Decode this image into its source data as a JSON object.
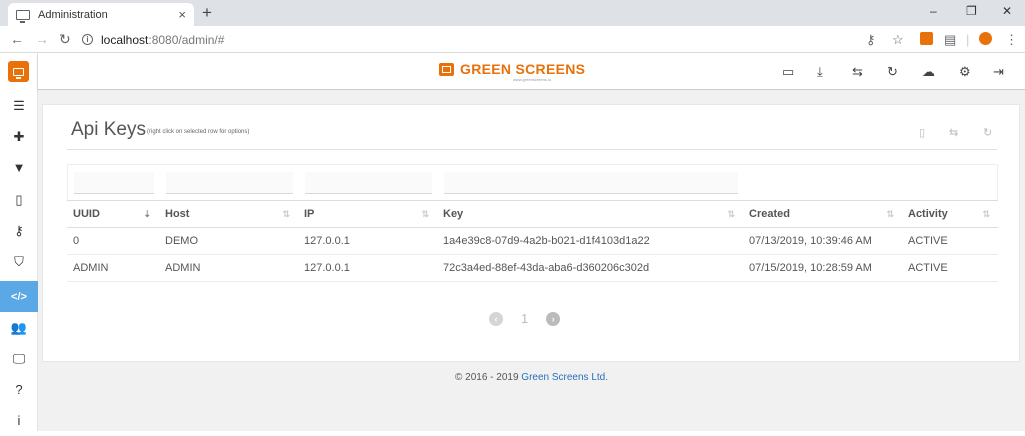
{
  "browser": {
    "tab_title": "Administration",
    "tab_close": "×",
    "new_tab": "+",
    "url_host": "localhost",
    "url_path": ":8080/admin/#",
    "win_minimize": "–",
    "win_restore": "❐",
    "win_close": "✕"
  },
  "app": {
    "brand_name_1": "GREEN",
    "brand_name_2": "SCREENS",
    "brand_sub": "www.greenscreens.io",
    "accent_color": "#e8710a",
    "active_color": "#5aa9e6",
    "sidebar": [
      {
        "icon": "list-icon",
        "glyph": "☰"
      },
      {
        "icon": "puzzle-icon",
        "glyph": "✚"
      },
      {
        "icon": "filter-icon",
        "glyph": "▼"
      },
      {
        "icon": "mobile-icon",
        "glyph": "▯"
      },
      {
        "icon": "key-icon",
        "glyph": "⚷"
      },
      {
        "icon": "shield-icon",
        "glyph": "⛉"
      },
      {
        "icon": "code-icon",
        "glyph": "</>"
      },
      {
        "icon": "users-icon",
        "glyph": "👥"
      },
      {
        "icon": "desktop-icon",
        "glyph": "🖵"
      },
      {
        "icon": "help-icon",
        "glyph": "?"
      },
      {
        "icon": "info-icon",
        "glyph": "i"
      }
    ],
    "topbar_icons": [
      "window-icon",
      "download-icon",
      "retweet-icon",
      "refresh-icon",
      "cloud-icon",
      "cogs-icon",
      "logout-icon"
    ]
  },
  "panel": {
    "title": "Api Keys",
    "hint": "(right click on selected row for options)",
    "columns": [
      "UUID",
      "Host",
      "IP",
      "Key",
      "Created",
      "Activity"
    ],
    "rows": [
      {
        "uuid": "0",
        "host": "DEMO",
        "ip": "127.0.0.1",
        "key": "1a4e39c8-07d9-4a2b-b021-d1f4103d1a22",
        "created": "07/13/2019, 10:39:46 AM",
        "activity": "ACTIVE"
      },
      {
        "uuid": "ADMIN",
        "host": "ADMIN",
        "ip": "127.0.0.1",
        "key": "72c3a4ed-88ef-43da-aba6-d360206c302d",
        "created": "07/15/2019, 10:28:59 AM",
        "activity": "ACTIVE"
      }
    ],
    "page": "1"
  },
  "footer": {
    "prefix": "© 2016 - 2019 ",
    "company": "Green Screens Ltd."
  }
}
